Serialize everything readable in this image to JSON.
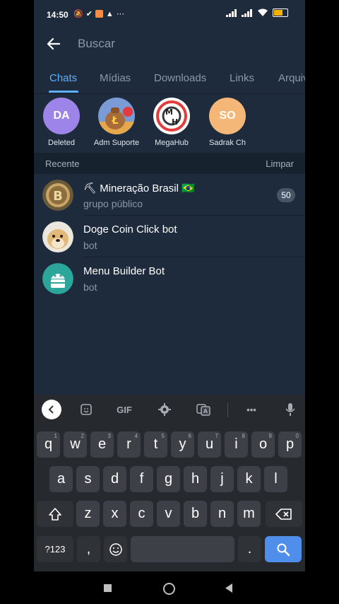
{
  "status_bar": {
    "time": "14:50"
  },
  "search": {
    "placeholder": "Buscar"
  },
  "tabs": [
    {
      "label": "Chats",
      "active": true
    },
    {
      "label": "Mídias",
      "active": false
    },
    {
      "label": "Downloads",
      "active": false
    },
    {
      "label": "Links",
      "active": false
    },
    {
      "label": "Arquivos",
      "active": false
    }
  ],
  "recent_people": [
    {
      "name": "Deleted",
      "initials": "DA",
      "color": "#9d84e8"
    },
    {
      "name": "Adm Suporte",
      "initials": "",
      "color": "#7a9bd6"
    },
    {
      "name": "MegaHub",
      "initials": "",
      "color": "#ffffff"
    },
    {
      "name": "Sadrak Ch",
      "initials": "SO",
      "color": "#f5b777"
    }
  ],
  "recent_section": {
    "title": "Recente",
    "clear_label": "Limpar"
  },
  "chats": [
    {
      "title": "⛏ Mineração Brasil 🇧🇷",
      "subtitle": "grupo público",
      "badge": "50"
    },
    {
      "title": "Doge Coin Click bot",
      "subtitle": "bot",
      "badge": ""
    },
    {
      "title": "Menu Builder Bot",
      "subtitle": "bot",
      "badge": ""
    }
  ],
  "keyboard": {
    "toolbar": {
      "gif_label": "GIF"
    },
    "row1": [
      "q",
      "w",
      "e",
      "r",
      "t",
      "y",
      "u",
      "i",
      "o",
      "p"
    ],
    "row1_hints": [
      "1",
      "2",
      "3",
      "4",
      "5",
      "6",
      "7",
      "8",
      "9",
      "0"
    ],
    "row2": [
      "a",
      "s",
      "d",
      "f",
      "g",
      "h",
      "j",
      "k",
      "l"
    ],
    "row3": [
      "z",
      "x",
      "c",
      "v",
      "b",
      "n",
      "m"
    ],
    "symbols_label": "?123",
    "comma": ",",
    "period": "."
  },
  "colors": {
    "accent": "#5cb0ff",
    "background": "#1e2b3c",
    "keyboard_action": "#4f8eea"
  }
}
